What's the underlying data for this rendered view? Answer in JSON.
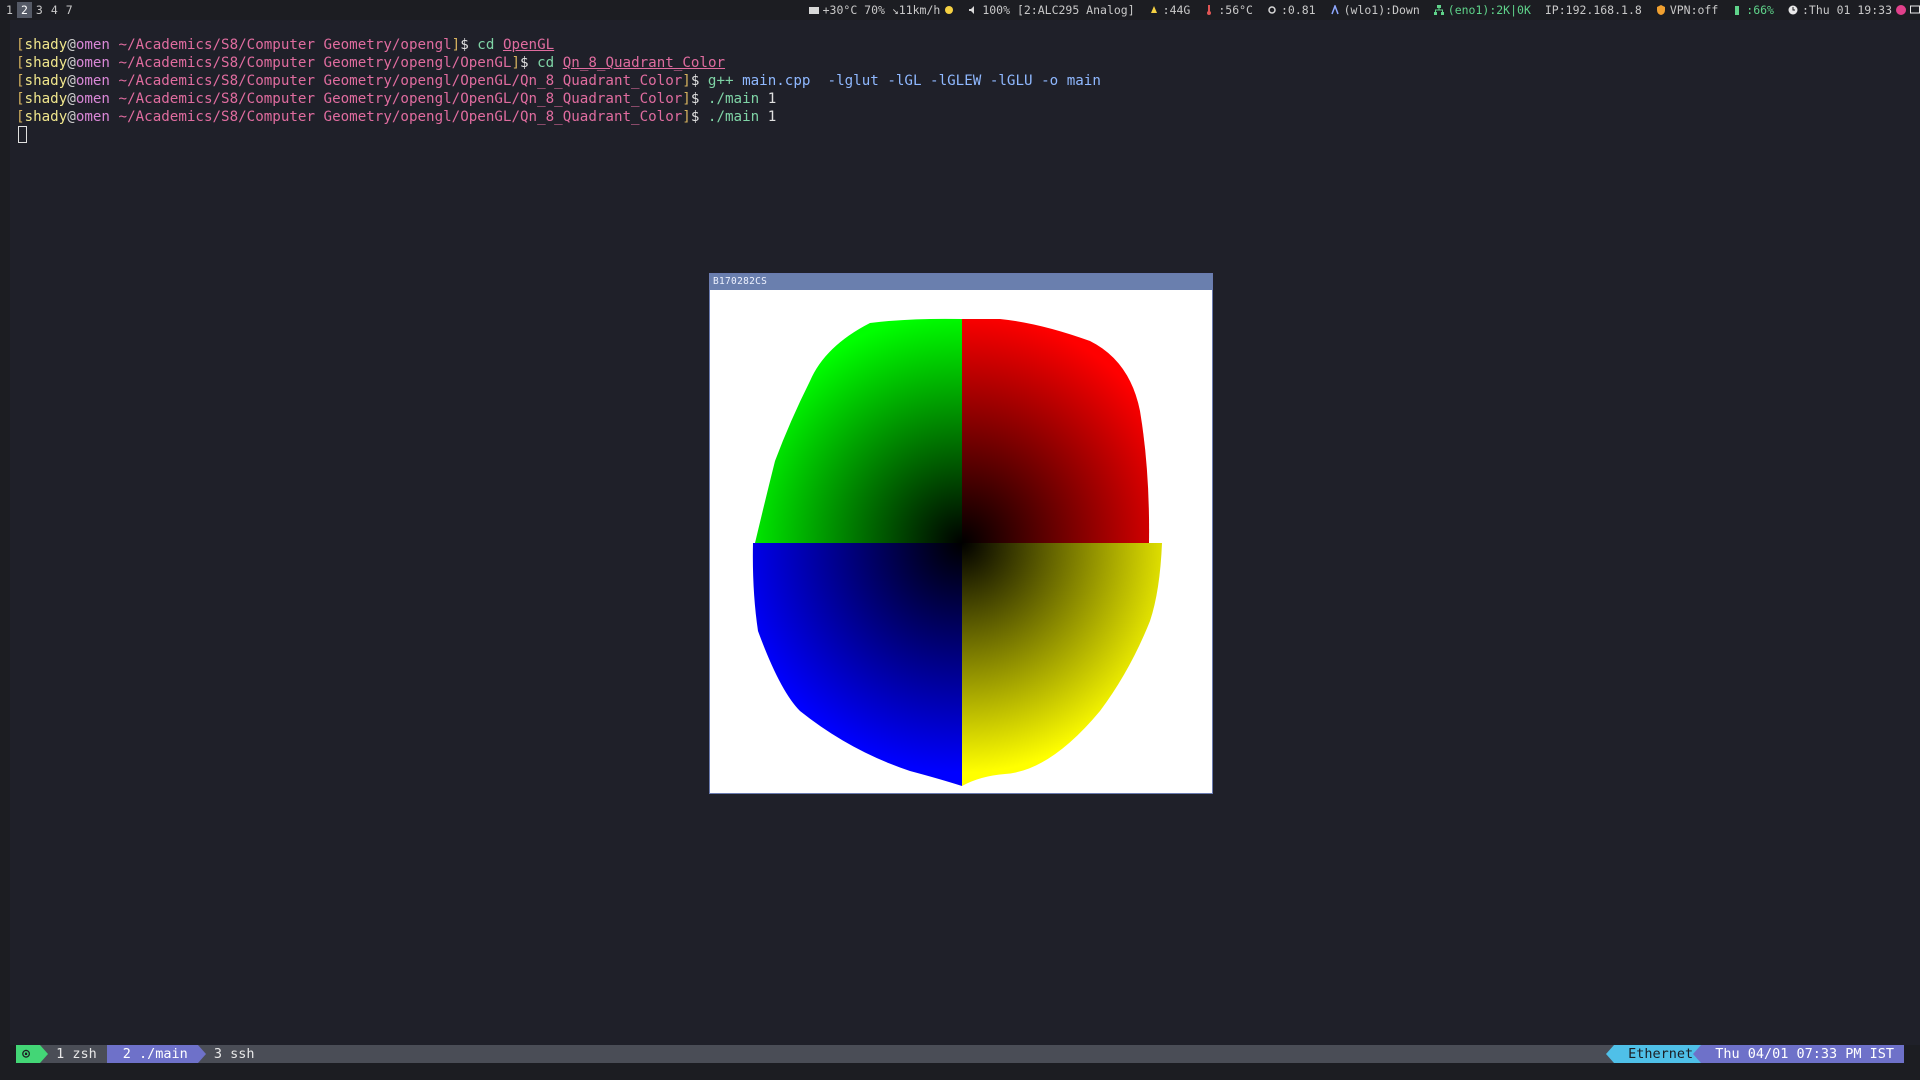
{
  "topbar": {
    "workspaces": [
      {
        "label": "1",
        "active": false
      },
      {
        "label": "2",
        "active": true
      },
      {
        "label": "3",
        "active": false
      },
      {
        "label": "4",
        "active": false
      },
      {
        "label": "7",
        "active": false
      }
    ],
    "weather": "+30°C 70% ↘11km/h",
    "volume": "100% [2:ALC295 Analog]",
    "disk": ":44G",
    "temperature": ":56°C",
    "load": ":0.81",
    "wifi": "(wlo1):Down",
    "ethernet": "(eno1):2K|0K",
    "ip": "IP:192.168.1.8",
    "vpn": "VPN:off",
    "battery": ":66%",
    "datetime": ":Thu 01 19:33"
  },
  "terminal": {
    "lines": [
      {
        "user": "shady",
        "host": "omen",
        "path": " ~/Academics/S8/Computer Geometry/opengl",
        "cmd": "cd",
        "args": [
          {
            "text": "OpenGL",
            "type": "arg"
          }
        ]
      },
      {
        "user": "shady",
        "host": "omen",
        "path": " ~/Academics/S8/Computer Geometry/opengl/OpenGL",
        "cmd": "cd",
        "args": [
          {
            "text": "Qn_8_Quadrant_Color",
            "type": "arg"
          }
        ]
      },
      {
        "user": "shady",
        "host": "omen",
        "path": " ~/Academics/S8/Computer Geometry/opengl/OpenGL/Qn_8_Quadrant_Color",
        "cmd": "g++",
        "args": [
          {
            "text": "main.cpp",
            "type": "flag"
          },
          {
            "text": " -lglut -lGL -lGLEW -lGLU -o main",
            "type": "flag"
          }
        ]
      },
      {
        "user": "shady",
        "host": "omen",
        "path": " ~/Academics/S8/Computer Geometry/opengl/OpenGL/Qn_8_Quadrant_Color",
        "cmd": "./main",
        "args": [
          {
            "text": "1",
            "type": "plain"
          }
        ]
      },
      {
        "user": "shady",
        "host": "omen",
        "path": " ~/Academics/S8/Computer Geometry/opengl/OpenGL/Qn_8_Quadrant_Color",
        "cmd": "./main",
        "args": [
          {
            "text": "1",
            "type": "plain"
          }
        ]
      }
    ]
  },
  "glwindow": {
    "title": "B170282CS",
    "quadrant_colors": {
      "top_right": "#ff0000",
      "top_left": "#00ff00",
      "bottom_left": "#0000ff",
      "bottom_right": "#ffff00"
    }
  },
  "tmux": {
    "session_icon": "⊙",
    "windows": [
      {
        "label": "1 zsh",
        "current": false
      },
      {
        "label": "2 ./main",
        "current": true
      },
      {
        "label": "3 ssh",
        "current": false
      }
    ],
    "network": "Ethernet",
    "clock": "Thu 04/01 07:33 PM IST"
  }
}
